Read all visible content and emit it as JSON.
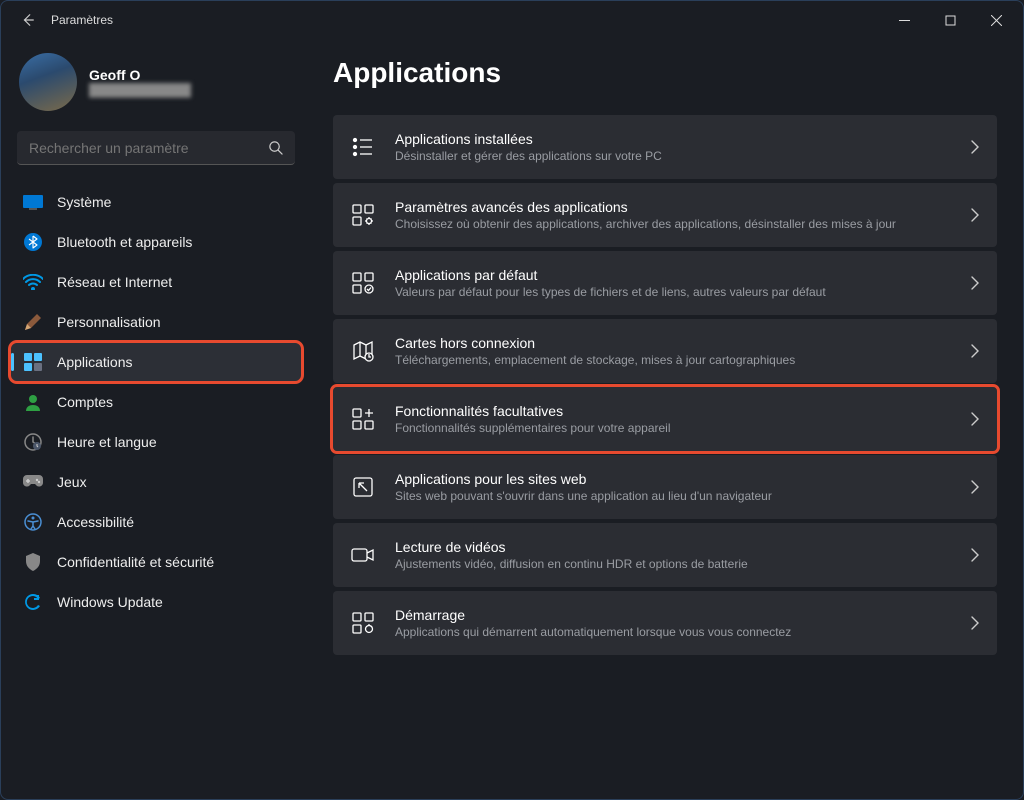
{
  "window": {
    "title": "Paramètres"
  },
  "profile": {
    "name": "Geoff O",
    "email": "████████████"
  },
  "search": {
    "placeholder": "Rechercher un paramètre"
  },
  "sidebar": {
    "items": [
      {
        "id": "system",
        "label": "Système"
      },
      {
        "id": "bluetooth",
        "label": "Bluetooth et appareils"
      },
      {
        "id": "network",
        "label": "Réseau et Internet"
      },
      {
        "id": "personalize",
        "label": "Personnalisation"
      },
      {
        "id": "apps",
        "label": "Applications",
        "active": true,
        "highlighted": true
      },
      {
        "id": "accounts",
        "label": "Comptes"
      },
      {
        "id": "time",
        "label": "Heure et langue"
      },
      {
        "id": "gaming",
        "label": "Jeux"
      },
      {
        "id": "accessibility",
        "label": "Accessibilité"
      },
      {
        "id": "privacy",
        "label": "Confidentialité et sécurité"
      },
      {
        "id": "update",
        "label": "Windows Update"
      }
    ]
  },
  "main": {
    "heading": "Applications",
    "cards": [
      {
        "id": "installed",
        "title": "Applications installées",
        "sub": "Désinstaller et gérer des applications sur votre PC"
      },
      {
        "id": "advanced",
        "title": "Paramètres avancés des applications",
        "sub": "Choisissez où obtenir des applications, archiver des applications, désinstaller des mises à jour"
      },
      {
        "id": "default",
        "title": "Applications par défaut",
        "sub": "Valeurs par défaut pour les types de fichiers et de liens, autres valeurs par défaut"
      },
      {
        "id": "maps",
        "title": "Cartes hors connexion",
        "sub": "Téléchargements, emplacement de stockage, mises à jour cartographiques"
      },
      {
        "id": "optional",
        "title": "Fonctionnalités facultatives",
        "sub": "Fonctionnalités supplémentaires pour votre appareil",
        "highlighted": true
      },
      {
        "id": "websites",
        "title": "Applications pour les sites web",
        "sub": "Sites web pouvant s'ouvrir dans une application au lieu d'un navigateur"
      },
      {
        "id": "video",
        "title": "Lecture de vidéos",
        "sub": "Ajustements vidéo, diffusion en continu HDR et options de batterie"
      },
      {
        "id": "startup",
        "title": "Démarrage",
        "sub": "Applications qui démarrent automatiquement lorsque vous vous connectez"
      }
    ]
  }
}
